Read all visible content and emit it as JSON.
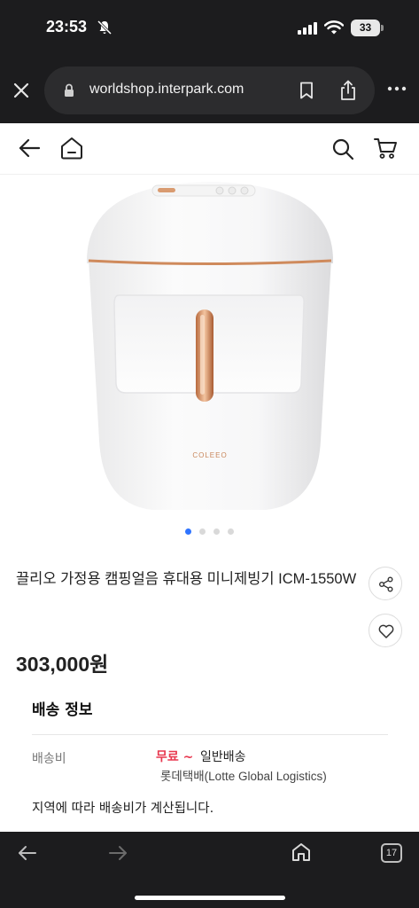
{
  "status_bar": {
    "time": "23:53",
    "battery": "33",
    "icons": [
      "bell-slash-icon",
      "signal-icon",
      "wifi-icon",
      "battery-icon"
    ]
  },
  "browser": {
    "url": "worldshop.interpark.com",
    "icons": [
      "close-icon",
      "lock-icon",
      "bookmark-icon",
      "share-icon",
      "more-icon"
    ],
    "tab_count": "17"
  },
  "site_header": {
    "icons": [
      "back-arrow-icon",
      "home-icon",
      "search-icon",
      "cart-icon"
    ]
  },
  "product": {
    "image_brand": "COLEEO",
    "image_count": 4,
    "active_image": 1,
    "title": "끌리오 가정용 캠핑얼음 휴대용 미니제빙기 ICM-1550W",
    "price": "303,000원"
  },
  "shipping": {
    "section_title": "배송 정보",
    "fee_label": "배송비",
    "fee_value": "무료 ~",
    "method": "일반배송",
    "carrier": "롯데택배(Lotte Global Logistics)",
    "note": "지역에 따라 배송비가 계산됩니다."
  },
  "colors": {
    "accent_red": "#e8384f",
    "active_dot": "#2f74ff",
    "chrome_dark": "#1c1c1e",
    "rose_gold": "#d08a5e"
  }
}
